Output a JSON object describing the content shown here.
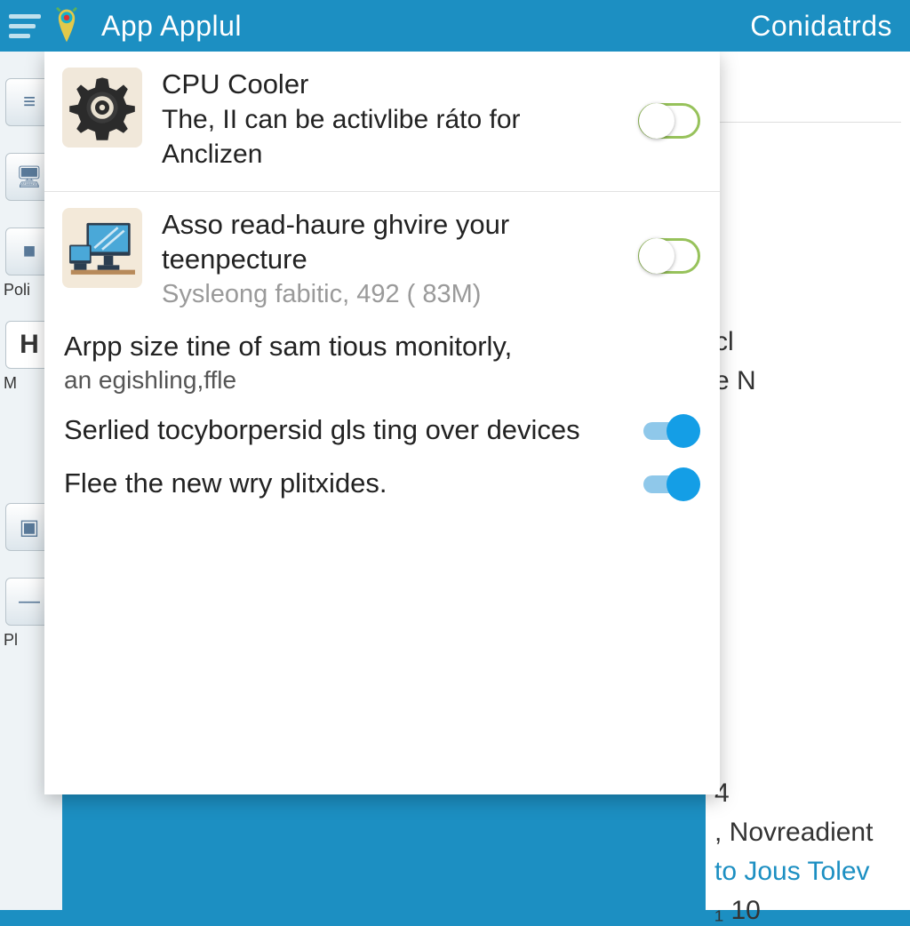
{
  "header": {
    "title": "App Applul",
    "right": "Conidatrds"
  },
  "bg_left": {
    "labels": [
      "Poli",
      "H",
      "M",
      "Pl"
    ]
  },
  "bg_right": {
    "line1": "cl",
    "line2": "e N",
    "bottom1": "4",
    "bottom2": ", Novreadient",
    "link": "to Jous Tolev",
    "last": "₁ 10"
  },
  "items": [
    {
      "title": "CPU Cooler",
      "sub": "The, II can be activlibe ráto for",
      "meta": "Anclizen"
    },
    {
      "title": "Asso read-haure ghvire your teenpecture",
      "meta": "Sysleong fabitic, 492 ( 83M)"
    }
  ],
  "rows": {
    "desc": "Arpp size tine of sam tious monitorly,",
    "desc_sub": "an egishling,ffle",
    "r1": "Serlied tocyborpersid gls ting over devices",
    "r2": "Flee the new wry plitxides."
  }
}
